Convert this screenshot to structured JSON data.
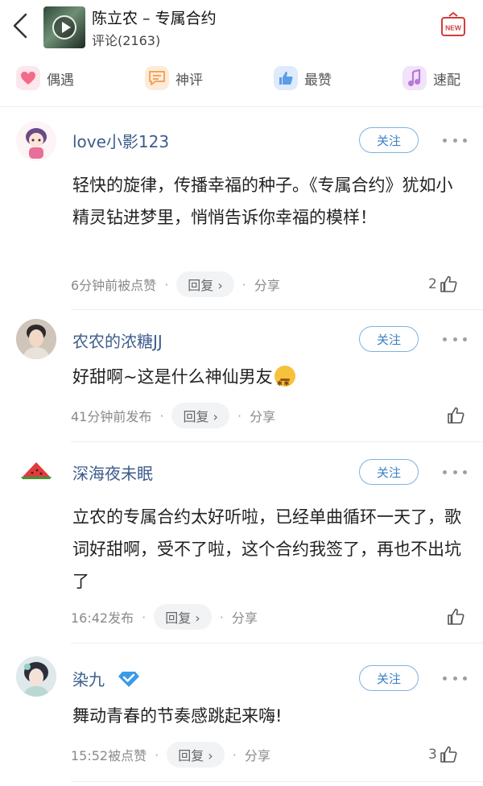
{
  "header": {
    "title": "陈立农 – 专属合约",
    "subtitle": "评论(2163)",
    "new_icon_label": "NEW"
  },
  "tabs": [
    {
      "label": "偶遇",
      "icon": "heart-icon",
      "color": "#f26b8a"
    },
    {
      "label": "神评",
      "icon": "chat-icon",
      "color": "#f2a65a"
    },
    {
      "label": "最赞",
      "icon": "thumb-up-icon",
      "color": "#5b9de6"
    },
    {
      "label": "速配",
      "icon": "music-note-icon",
      "color": "#b779d9"
    }
  ],
  "colors": {
    "username": "#3d5d8c",
    "follow": "#3b7fc4",
    "meta": "#8a8a8a"
  },
  "comments": [
    {
      "username": "love小影123",
      "follow": "关注",
      "text": "轻快的旋律，传播幸福的种子。《专属合约》犹如小精灵钻进梦里，悄悄告诉你幸福的模样！",
      "time": "6分钟前被点赞",
      "reply": "回复 ›",
      "share": "分享",
      "likes": "2"
    },
    {
      "username": "农农的浓糖JJ",
      "follow": "关注",
      "text": "好甜啊~这是什么神仙男友",
      "time": "41分钟前发布",
      "reply": "回复 ›",
      "share": "分享",
      "likes": ""
    },
    {
      "username": "深海夜未眠",
      "follow": "关注",
      "text": "立农的专属合约太好听啦，已经单曲循环一天了，歌词好甜啊，受不了啦，这个合约我签了，再也不出坑了",
      "time": "16:42发布",
      "reply": "回复 ›",
      "share": "分享",
      "likes": ""
    },
    {
      "username": "染九",
      "follow": "关注",
      "text": "舞动青春的节奏感跳起来嗨!",
      "time": "15:52被点赞",
      "reply": "回复 ›",
      "share": "分享",
      "likes": "3"
    }
  ],
  "meta_dot": "·"
}
